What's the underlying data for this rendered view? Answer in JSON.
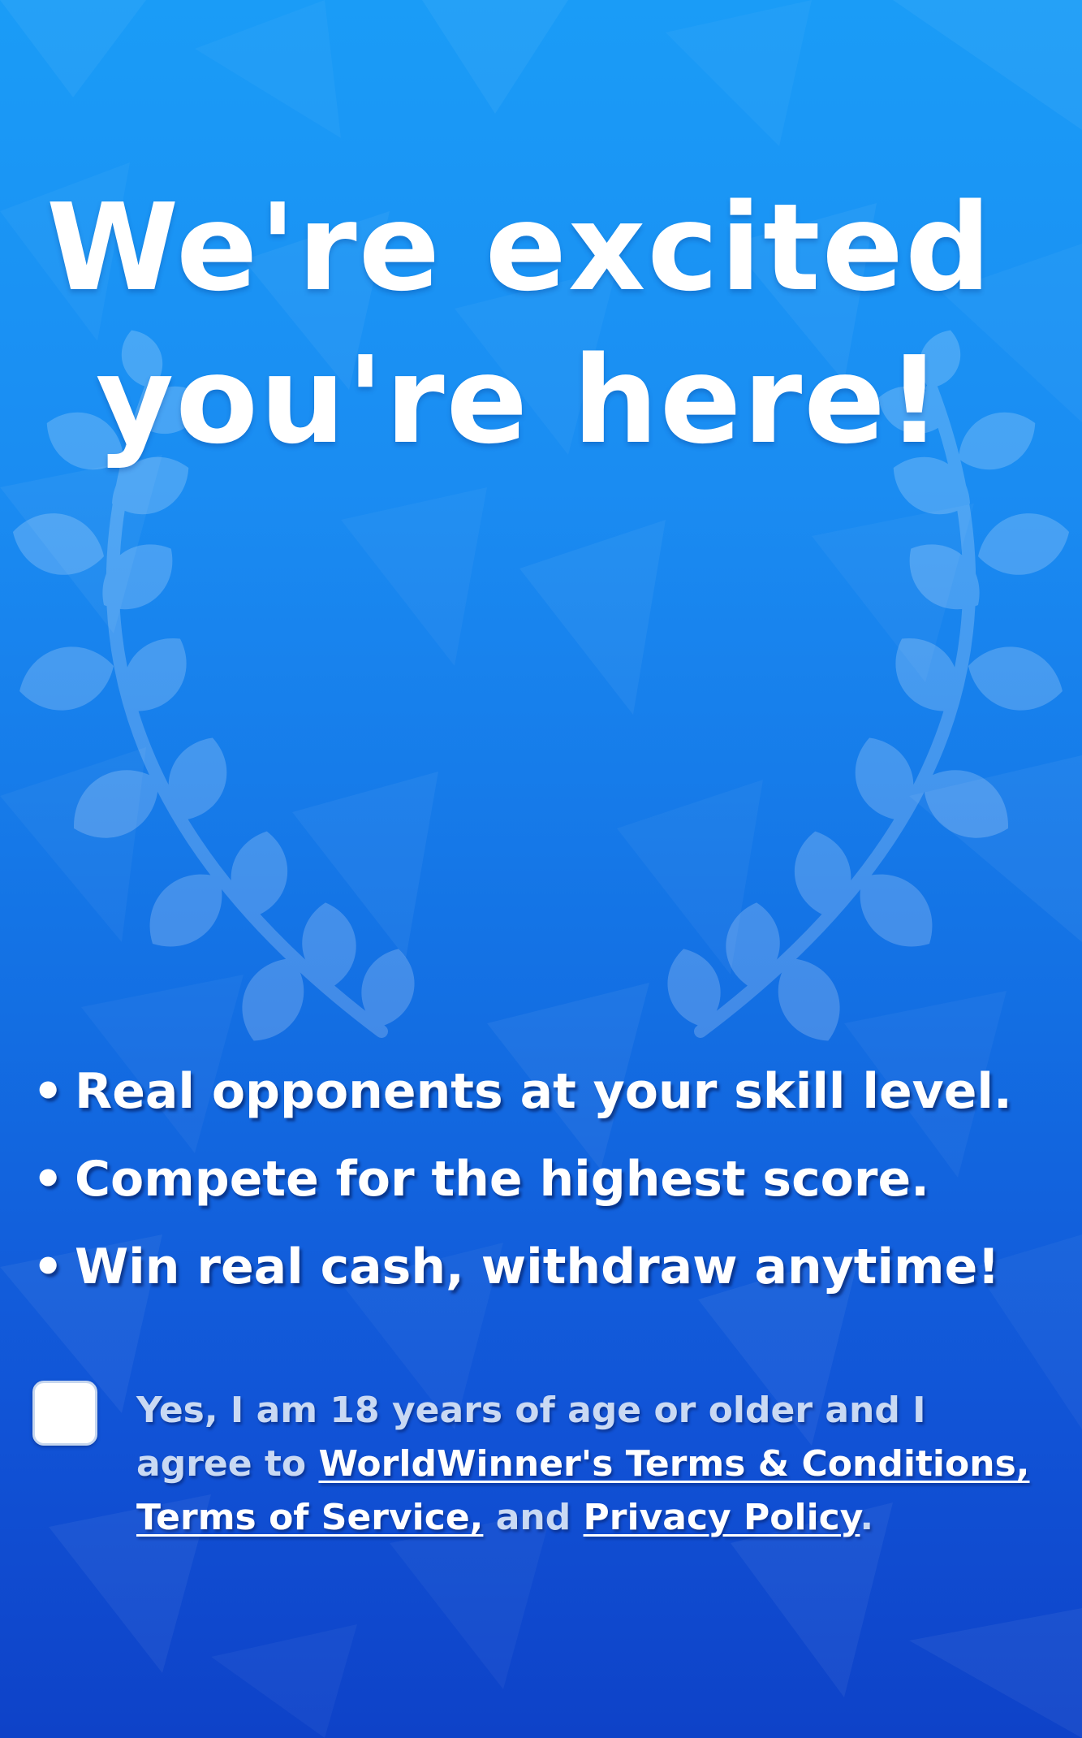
{
  "screen": {
    "colors": {
      "background_top": "#1a9cf7",
      "background_bottom": "#0e42c8",
      "text": "#ffffff",
      "consent_text": "#c9d9f3"
    },
    "decoration": "laurel-wreath"
  },
  "headline": {
    "line1": "We're excited",
    "line2": "you're here!"
  },
  "bullets": {
    "marker": "•",
    "items": [
      "Real opponents at your skill level.",
      "Compete for the highest score.",
      "Win real cash, withdraw anytime!"
    ]
  },
  "consent": {
    "checked": false,
    "line1": "Yes, I am 18 years of age or older and I",
    "agree_prefix": "agree to ",
    "terms_conditions_link": "WorldWinner's Terms & Conditions,",
    "terms_service_link": "Terms of Service,",
    "and_text": " and ",
    "privacy_link": "Privacy Policy",
    "period": "."
  }
}
